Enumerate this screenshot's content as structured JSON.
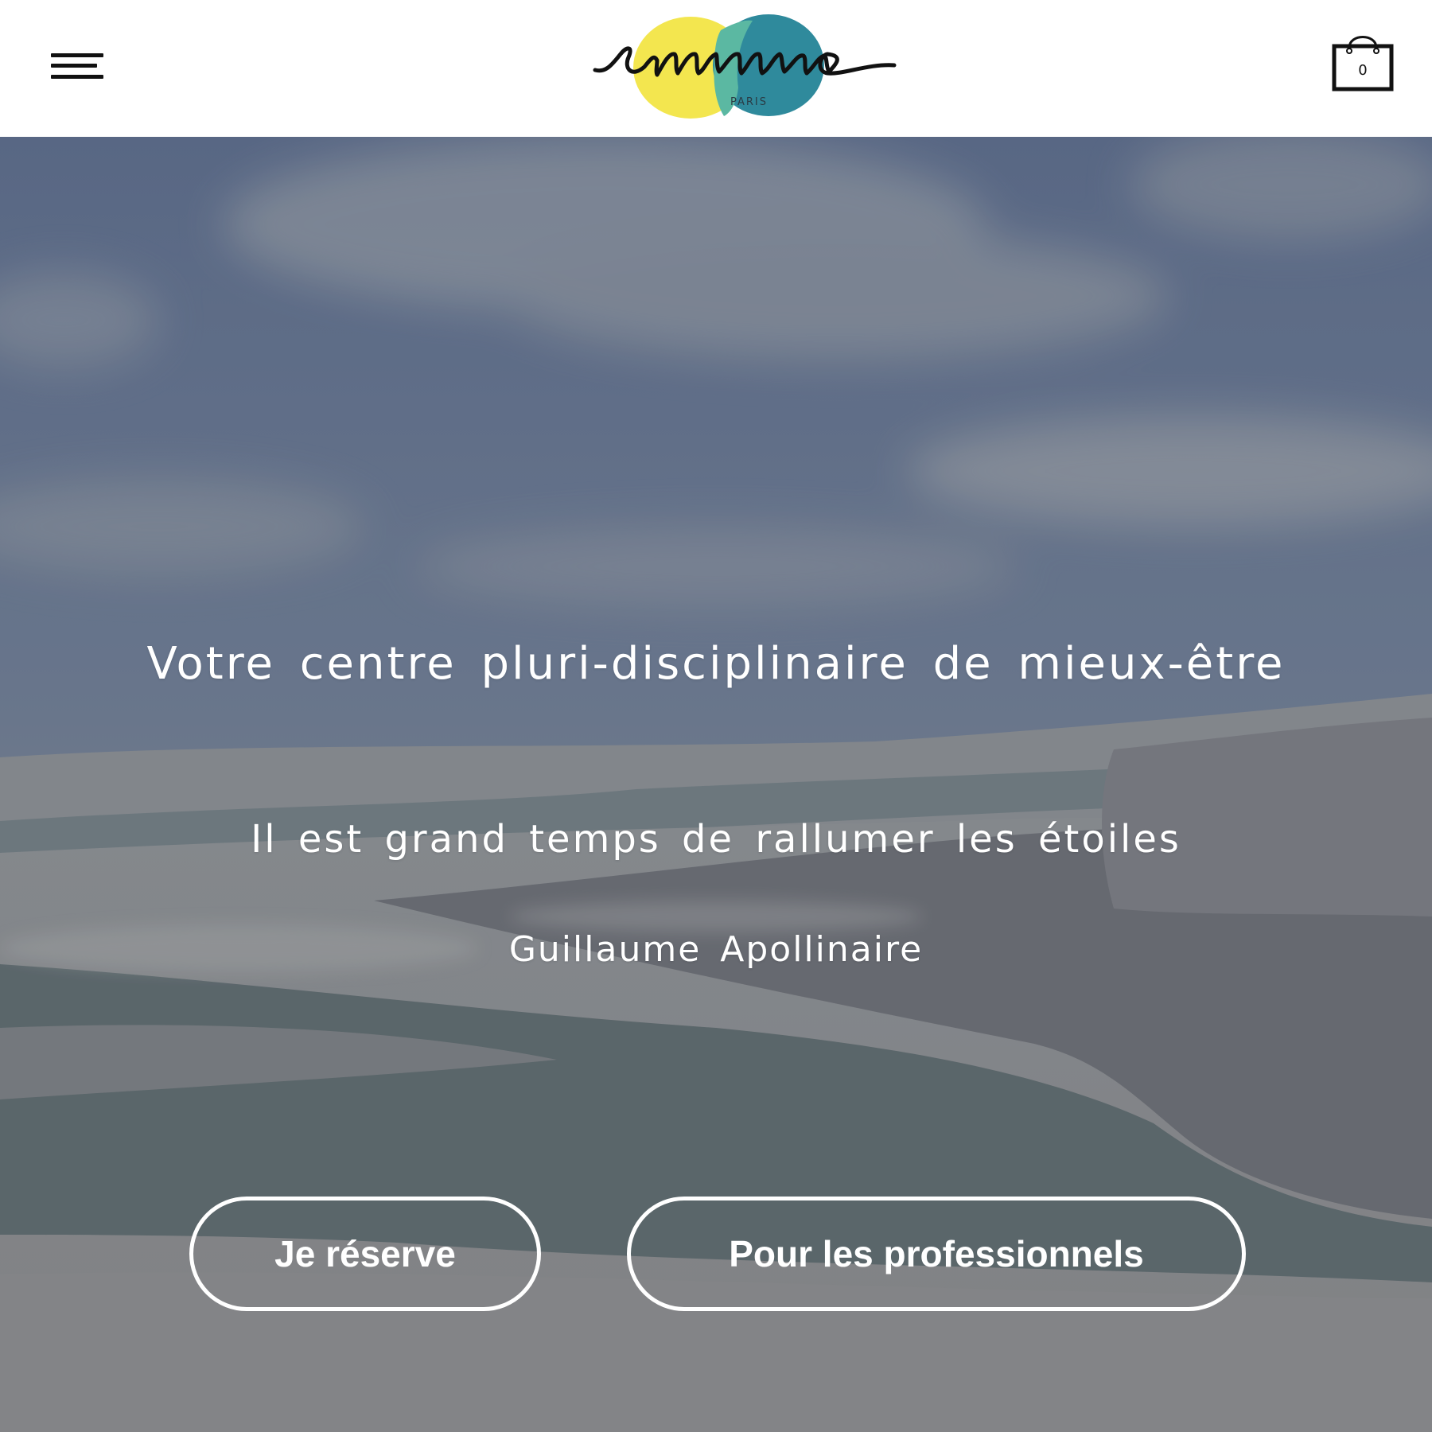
{
  "header": {
    "menu_icon": "hamburger-menu-icon",
    "logo_text": "emma",
    "logo_sub": "PARIS",
    "cart_icon": "shopping-bag-icon",
    "cart_count": "0"
  },
  "hero": {
    "tagline": "Votre centre pluri-disciplinaire de mieux-être",
    "quote": "Il est grand temps de rallumer les étoiles",
    "author": "Guillaume Apollinaire",
    "buttons": {
      "reserve": "Je réserve",
      "pro": "Pour les professionnels"
    }
  },
  "colors": {
    "logo_yellow": "#f3e64f",
    "logo_teal": "#2f8a9c",
    "logo_overlap": "#5bb8a2",
    "text": "#ffffff"
  }
}
